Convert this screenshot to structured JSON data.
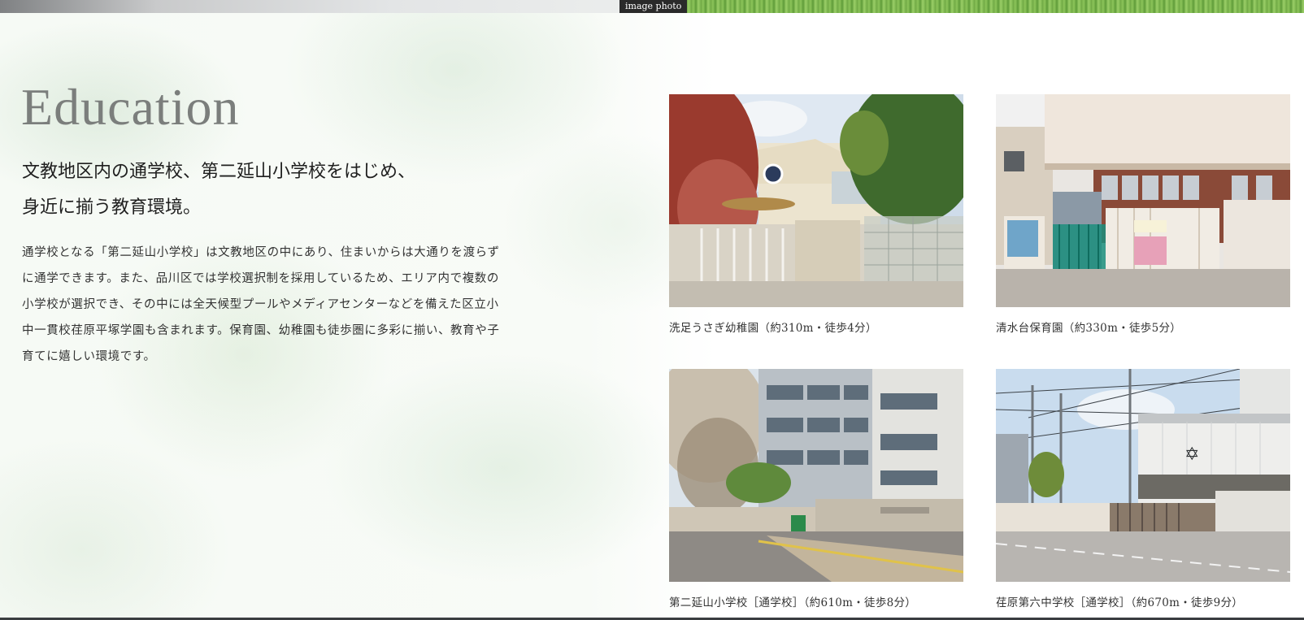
{
  "header": {
    "image_tag": "image photo"
  },
  "section": {
    "title": "Education",
    "lead_lines": [
      "文教地区内の通学校、第二延山小学校をはじめ、",
      "身近に揃う教育環境。"
    ],
    "body_lines": [
      "通学校となる「第二延山小学校」は文教地区の中にあり、住まいからは大通りを渡らず",
      "に通学できます。また、品川区では学校選択制を採用しているため、エリア内で複数の",
      "小学校が選択でき、その中には全天候型プールやメディアセンターなどを備えた区立小",
      "中一貫校荏原平塚学園も含まれます。保育園、幼稚園も徒歩圏に多彩に揃い、教育や子",
      "育てに嬉しい環境です。"
    ]
  },
  "facilities": [
    {
      "caption": "洗足うさぎ幼稚園（約310m・徒歩4分）"
    },
    {
      "caption": "清水台保育園（約330m・徒歩5分）"
    },
    {
      "caption": "第二延山小学校［通学校］（約610m・徒歩8分）"
    },
    {
      "caption": "荏原第六中学校［通学校］（約670m・徒歩9分）"
    }
  ],
  "colors": {
    "title": "#7b7e7c",
    "text": "#333333",
    "tag_bg": "#2a2a2a"
  }
}
